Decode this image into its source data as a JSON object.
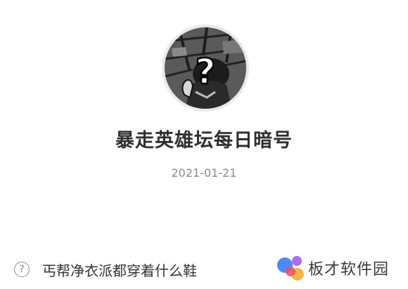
{
  "post": {
    "avatar_icon": "question-mark-avatar",
    "title": "暴走英雄坛每日暗号",
    "date": "2021-01-21"
  },
  "question": {
    "icon": "help-circle-icon",
    "icon_glyph": "?",
    "text": "丐帮净衣派都穿着什么鞋"
  },
  "brand": {
    "logo_icon": "colored-dots-logo",
    "name": "板才软件园",
    "colors": [
      "#3b7cf5",
      "#f04a6a",
      "#a25cf0",
      "#f7b23a"
    ]
  }
}
